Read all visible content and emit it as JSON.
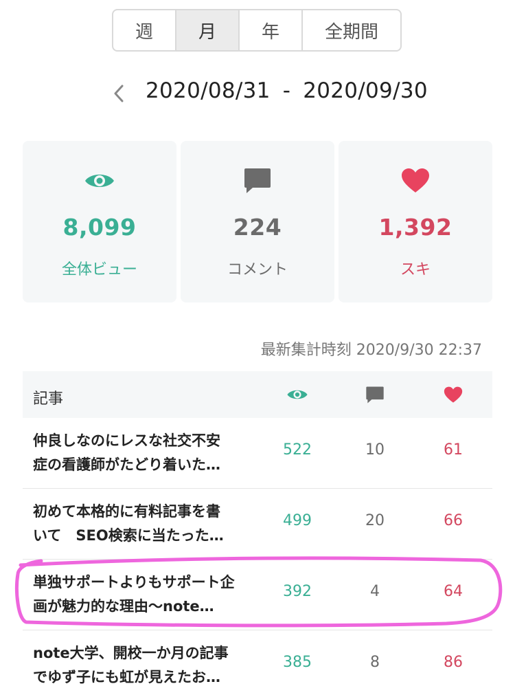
{
  "tabs": [
    {
      "label": "週",
      "active": false
    },
    {
      "label": "月",
      "active": true
    },
    {
      "label": "年",
      "active": false
    },
    {
      "label": "全期間",
      "active": false
    }
  ],
  "range": {
    "start": "2020/08/31",
    "separator": "-",
    "end": "2020/09/30"
  },
  "stats": {
    "views": {
      "value": "8,099",
      "label": "全体ビュー",
      "color": "#3aaf94"
    },
    "comments": {
      "value": "224",
      "label": "コメント",
      "color": "#6b6b6b"
    },
    "likes": {
      "value": "1,392",
      "label": "スキ",
      "color": "#d3475f"
    }
  },
  "updated": "最新集計時刻 2020/9/30 22:37",
  "table": {
    "header_title": "記事",
    "rows": [
      {
        "title_line1": "仲良しなのにレスな社交不安",
        "title_line2": "症の看護師がたどり着いた…",
        "views": "522",
        "comments": "10",
        "likes": "61"
      },
      {
        "title_line1": "初めて本格的に有料記事を書",
        "title_line2": "いて　SEO検索に当たった…",
        "views": "499",
        "comments": "20",
        "likes": "66"
      },
      {
        "title_line1": "単独サポートよりもサポート企",
        "title_line2": "画が魅力的な理由〜note…",
        "views": "392",
        "comments": "4",
        "likes": "64"
      },
      {
        "title_line1": "note大学、開校一か月の記事",
        "title_line2": "でゆず子にも虹が見えたお…",
        "views": "385",
        "comments": "8",
        "likes": "86"
      }
    ]
  },
  "icons": {
    "back": "chevron-left-icon",
    "views": "eye-icon",
    "comments": "speech-bubble-icon",
    "likes": "heart-icon"
  },
  "highlight_color": "#ee66dd"
}
